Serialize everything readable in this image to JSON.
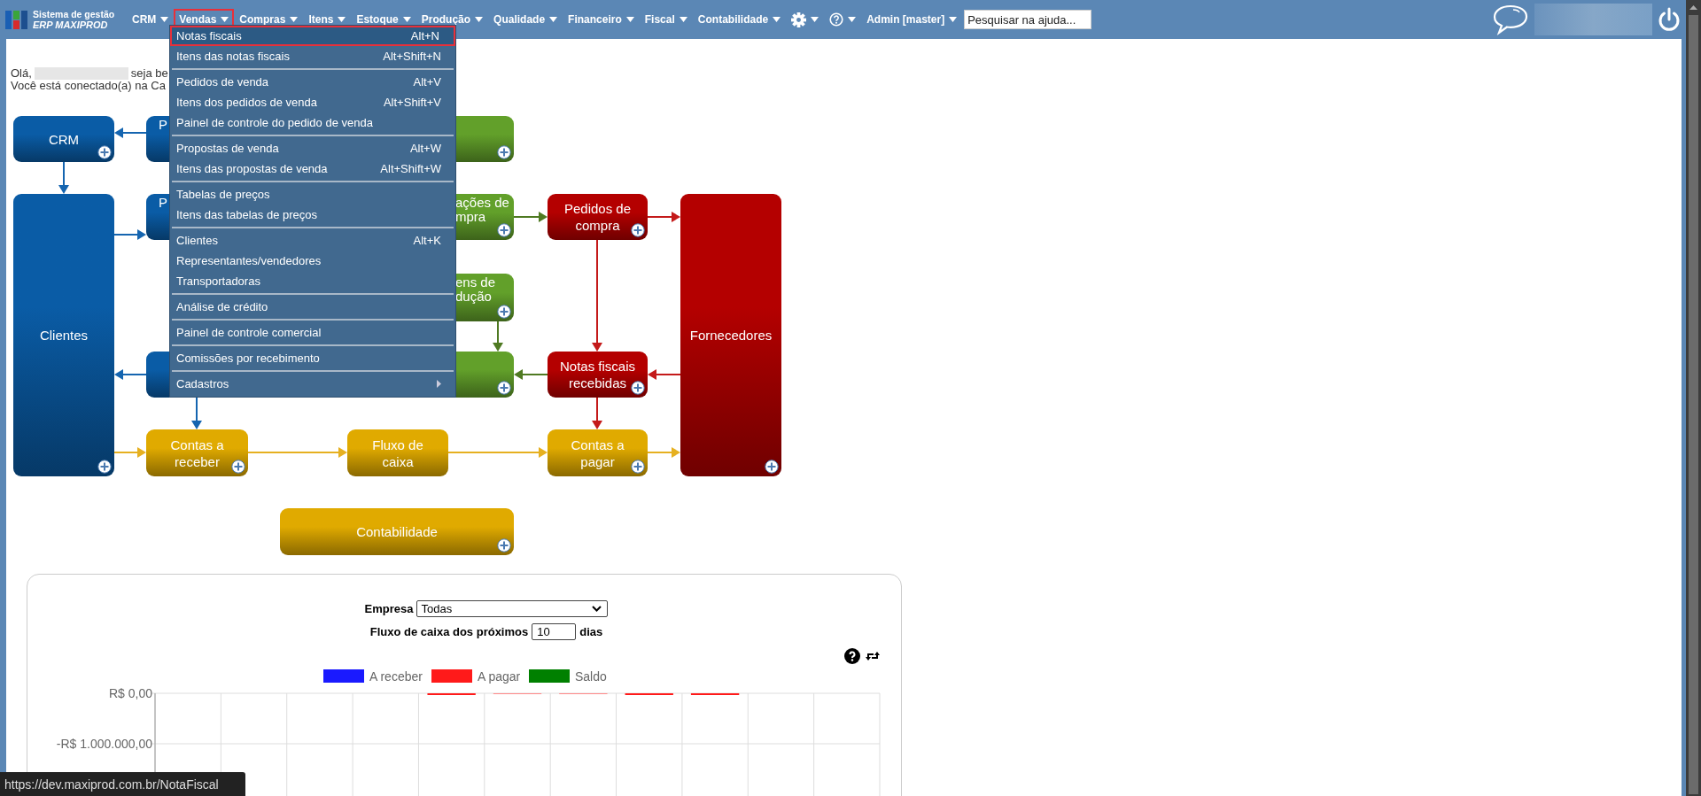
{
  "header": {
    "logo_line1": "Sistema de gestão",
    "logo_line2": "ERP MAXIPROD"
  },
  "nav": [
    {
      "kind": "text",
      "label": "CRM",
      "selected": false
    },
    {
      "kind": "text",
      "label": "Vendas",
      "selected": true
    },
    {
      "kind": "text",
      "label": "Compras",
      "selected": false
    },
    {
      "kind": "text",
      "label": "Itens",
      "selected": false
    },
    {
      "kind": "text",
      "label": "Estoque",
      "selected": false
    },
    {
      "kind": "text",
      "label": "Produção",
      "selected": false
    },
    {
      "kind": "text",
      "label": "Qualidade",
      "selected": false
    },
    {
      "kind": "text",
      "label": "Financeiro",
      "selected": false
    },
    {
      "kind": "text",
      "label": "Fiscal",
      "selected": false
    },
    {
      "kind": "text",
      "label": "Contabilidade",
      "selected": false
    },
    {
      "kind": "settings",
      "selected": false
    },
    {
      "kind": "help",
      "selected": false
    },
    {
      "kind": "text",
      "label": "Admin [master]",
      "selected": false
    }
  ],
  "search": {
    "placeholder": "Pesquisar na ajuda..."
  },
  "menu": {
    "groups": [
      [
        {
          "kind": "item",
          "label": "Notas fiscais",
          "shortcut": "Alt+N",
          "selected": true
        },
        {
          "kind": "item",
          "label": "Itens das notas fiscais",
          "shortcut": "Alt+Shift+N",
          "selected": false
        }
      ],
      [
        {
          "kind": "item",
          "label": "Pedidos de venda",
          "shortcut": "Alt+V",
          "selected": false
        },
        {
          "kind": "item",
          "label": "Itens dos pedidos de venda",
          "shortcut": "Alt+Shift+V",
          "selected": false
        },
        {
          "kind": "item",
          "label": "Painel de controle do pedido de venda",
          "selected": false
        }
      ],
      [
        {
          "kind": "item",
          "label": "Propostas de venda",
          "shortcut": "Alt+W",
          "selected": false
        },
        {
          "kind": "item",
          "label": "Itens das propostas de venda",
          "shortcut": "Alt+Shift+W",
          "selected": false
        }
      ],
      [
        {
          "kind": "item",
          "label": "Tabelas de preços",
          "selected": false
        },
        {
          "kind": "item",
          "label": "Itens das tabelas de preços",
          "selected": false
        }
      ],
      [
        {
          "kind": "item",
          "label": "Clientes",
          "shortcut": "Alt+K",
          "selected": false
        },
        {
          "kind": "item",
          "label": "Representantes/vendedores",
          "selected": false
        },
        {
          "kind": "item",
          "label": "Transportadoras",
          "selected": false
        }
      ],
      [
        {
          "kind": "item",
          "label": "Análise de crédito",
          "selected": false
        }
      ],
      [
        {
          "kind": "item",
          "label": "Painel de controle comercial",
          "selected": false
        }
      ],
      [
        {
          "kind": "item",
          "label": "Comissões por recebimento",
          "selected": false
        }
      ],
      [
        {
          "kind": "submenu",
          "label": "Cadastros",
          "selected": false
        }
      ]
    ]
  },
  "greeting": {
    "hello": "Olá,",
    "continuation": "seja be",
    "connected": "Você está conectado(a) na Ca"
  },
  "diagram": {
    "nodes": [
      {
        "label": "CRM",
        "color": "#0a5ca6",
        "add_button": true
      },
      {
        "label": "P",
        "color": "#0a5ca6",
        "add_button": false
      },
      {
        "color": "#62a02a",
        "add_button": true
      },
      {
        "label": "Clientes",
        "color": "#0a5ca6",
        "add_button": true
      },
      {
        "label": "P",
        "color": "#0a5ca6",
        "add_button": false
      },
      {
        "label": "ações de\nmpra",
        "color": "#62a02a",
        "add_button": true
      },
      {
        "label": "Pedidos de\ncompra",
        "color": "#b40000",
        "add_button": true
      },
      {
        "label": "Fornecedores",
        "color": "#b40000",
        "add_button": true
      },
      {
        "label": "ens de\ndução",
        "color": "#62a02a",
        "add_button": true
      },
      {
        "color": "#0a5ca6",
        "add_button": false
      },
      {
        "color": "#62a02a",
        "add_button": true
      },
      {
        "label": "Notas fiscais\nrecebidas",
        "color": "#b40000",
        "add_button": true
      },
      {
        "label": "Contas a\nreceber",
        "color": "#e0aa00",
        "add_button": true
      },
      {
        "label": "Fluxo de\ncaixa",
        "color": "#e0aa00",
        "add_button": false
      },
      {
        "label": "Contas a\npagar",
        "color": "#e0aa00",
        "add_button": true
      },
      {
        "label": "Contabilidade",
        "color": "#e0aa00",
        "add_button": true
      }
    ]
  },
  "cash_flow": {
    "company_label": "Empresa",
    "company_value": "Todas",
    "days_label": "Fluxo de caixa dos próximos",
    "days_value": "10",
    "days_unit": "dias",
    "legend": [
      {
        "name": "A receber",
        "color": "#1a1aff"
      },
      {
        "name": "A pagar",
        "color": "#ff1a1a"
      },
      {
        "name": "Saldo",
        "color": "#008000"
      }
    ],
    "y_axis_labels": [
      "R$ 0,00",
      "-R$ 1.000.000,00"
    ]
  },
  "status_url": "https://dev.maxiprod.com.br/NotaFiscal"
}
